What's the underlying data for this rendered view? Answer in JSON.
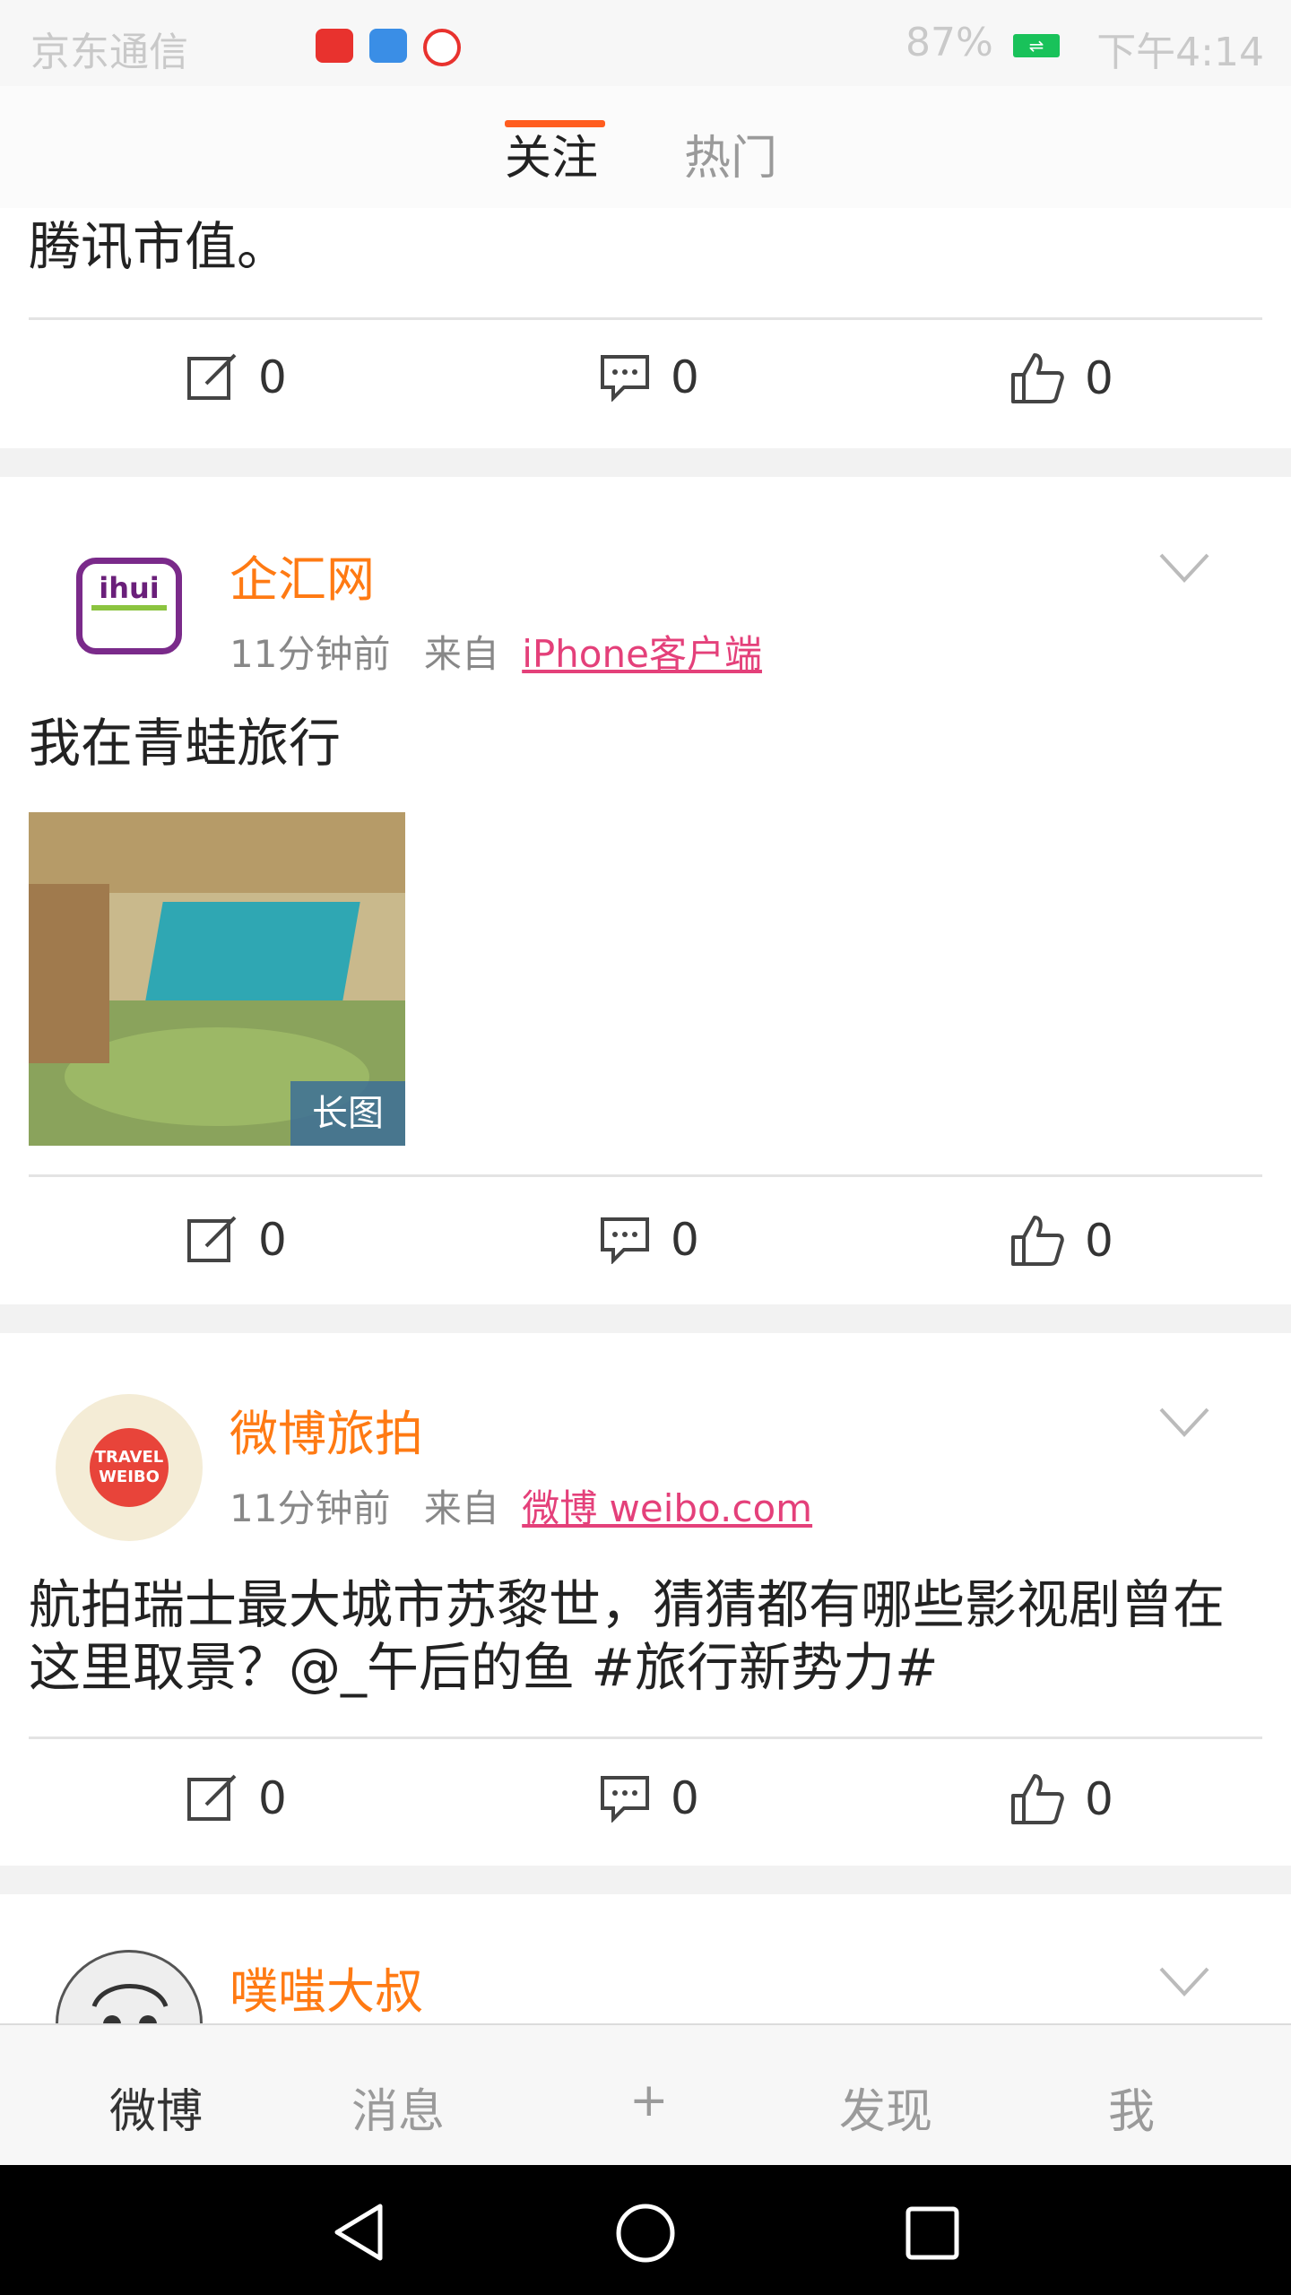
{
  "status_bar": {
    "carrier": "京东通信",
    "app_icons": [
      "头条",
      "汽车之家",
      "视频"
    ],
    "battery": "87%",
    "time": "下午4:14"
  },
  "top_tabs": [
    {
      "label": "关注",
      "active": true
    },
    {
      "label": "热门",
      "active": false
    }
  ],
  "posts": [
    {
      "partial": true,
      "text": "腾讯市值。",
      "actions": {
        "repost": "0",
        "comment": "0",
        "like": "0"
      }
    },
    {
      "username": "企汇网",
      "avatar": "ihui-logo",
      "time": "11分钟前",
      "from_label": "来自",
      "source": "iPhone客户端",
      "text": "我在青蛙旅行",
      "image_badge": "长图",
      "actions": {
        "repost": "0",
        "comment": "0",
        "like": "0"
      }
    },
    {
      "username": "微博旅拍",
      "avatar": "travel-weibo-logo",
      "time": "11分钟前",
      "from_label": "来自",
      "source": "微博 weibo.com",
      "text": "航拍瑞士最大城市苏黎世，猜猜都有哪些影视剧曾在这里取景？@_午后的鱼 #旅行新势力#",
      "actions": {
        "repost": "0",
        "comment": "0",
        "like": "0"
      }
    },
    {
      "username": "噗嗤大叔",
      "avatar": "sketch-face-avatar",
      "partial": true
    }
  ],
  "bottom_nav": [
    {
      "label": "微博",
      "active": true
    },
    {
      "label": "消息",
      "active": false
    },
    {
      "label": "+",
      "active": false
    },
    {
      "label": "发现",
      "active": false
    },
    {
      "label": "我",
      "active": false
    }
  ],
  "colors": {
    "accent": "#ff5d1f",
    "username": "#ff7a13",
    "source_link": "#e4407a"
  }
}
